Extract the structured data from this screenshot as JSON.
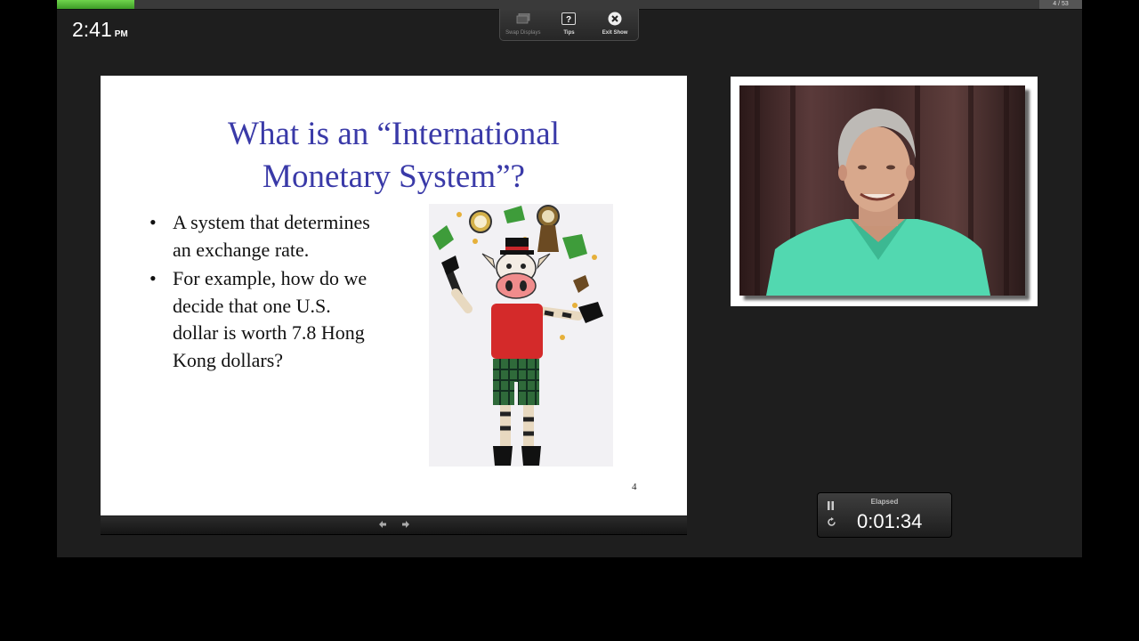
{
  "app": {
    "clock_time": "2:41",
    "clock_ampm": "PM",
    "slide_counter": "4 / 53",
    "progress_fraction": 0.0755
  },
  "toolbar": {
    "items": [
      {
        "label": "Swap Displays",
        "icon": "swap-displays-icon",
        "enabled": false
      },
      {
        "label": "Tips",
        "icon": "question-icon",
        "enabled": true
      },
      {
        "label": "Exit Show",
        "icon": "close-circle-icon",
        "enabled": true
      }
    ]
  },
  "slide": {
    "title_line1": "What is an “International",
    "title_line2": "Monetary System”?",
    "bullets": [
      "A system that determines an exchange rate.",
      "For example, how do we decide that one U.S. dollar is worth 7.8 Hong Kong dollars?"
    ],
    "image": "cartoon-cow-juggling-money-clocks",
    "number": "4",
    "title_color": "#3a3aa8"
  },
  "nav": {
    "prev_icon": "arrow-left-icon",
    "next_icon": "arrow-right-icon"
  },
  "presenter_video": {
    "subject": "presenter-webcam-feed"
  },
  "timer": {
    "label": "Elapsed",
    "value": "0:01:34",
    "pause_icon": "pause-icon",
    "reset_icon": "reset-icon"
  },
  "colors": {
    "progress": "#4fb531",
    "background": "#1e1e1e"
  }
}
